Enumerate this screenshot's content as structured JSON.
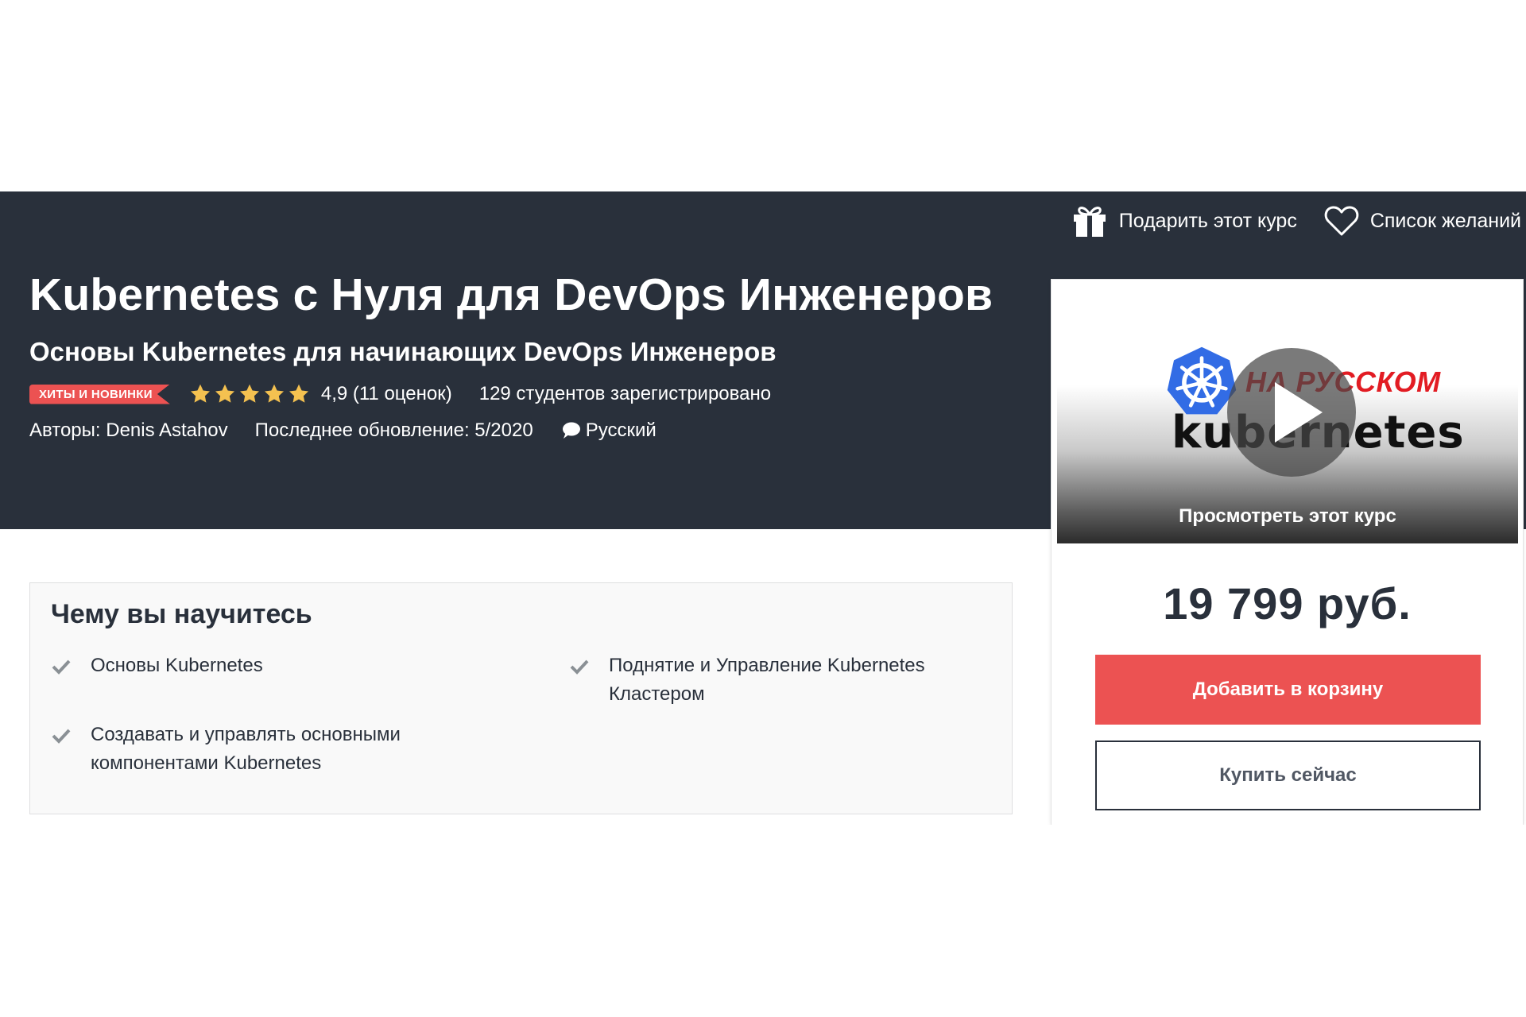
{
  "header": {
    "gift_label": "Подарить этот курс",
    "wishlist_label": "Список желаний"
  },
  "course": {
    "title": "Kubernetes с Нуля для DevOps Инженеров",
    "subtitle": "Основы Kubernetes для начинающих DevOps Инженеров",
    "badge": "ХИТЫ И НОВИНКИ",
    "stars": 5,
    "rating_text": "4,9 (11 оценок)",
    "students_text": "129 студентов зарегистрировано",
    "authors_text": "Авторы: Denis Astahov",
    "updated_text": "Последнее обновление: 5/2020",
    "language": "Русский"
  },
  "preview": {
    "overlay_red_text": "НА РУССКОМ",
    "logo_word": "kubernetes",
    "caption": "Просмотреть этот курс"
  },
  "purchase": {
    "price": "19 799 руб.",
    "add_to_cart_label": "Добавить в корзину",
    "buy_now_label": "Купить сейчас"
  },
  "learn": {
    "title": "Чему вы научитесь",
    "items": [
      "Основы Kubernetes",
      "Поднятие и Управление Kubernetes Кластером",
      "Создавать и управлять основными компонентами Kubernetes"
    ]
  },
  "colors": {
    "banner": "#29303b",
    "accent_red": "#ec5252",
    "star": "#f4c150"
  }
}
